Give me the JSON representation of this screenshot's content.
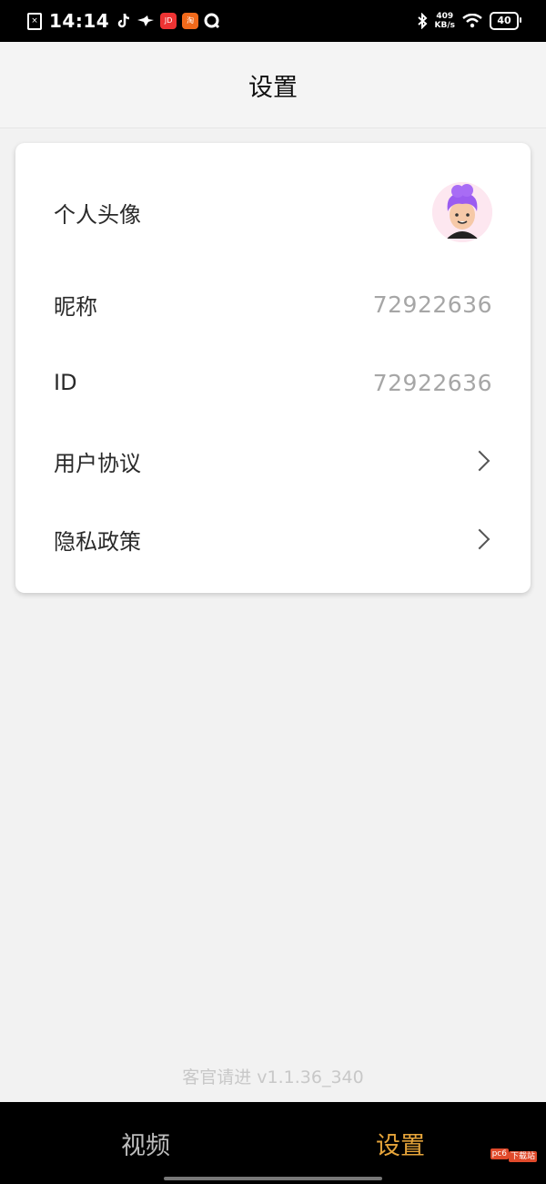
{
  "status_bar": {
    "time": "14:14",
    "net_speed_value": "409",
    "net_speed_unit": "KB/s",
    "battery": "40"
  },
  "header": {
    "title": "设置"
  },
  "settings": {
    "avatar_label": "个人头像",
    "nickname_label": "昵称",
    "nickname_value": "72922636",
    "id_label": "ID",
    "id_value": "72922636",
    "user_agreement_label": "用户协议",
    "privacy_policy_label": "隐私政策"
  },
  "footer": {
    "version": "客官请进 v1.1.36_340"
  },
  "bottom_nav": {
    "items": [
      {
        "label": "视频",
        "active": false
      },
      {
        "label": "设置",
        "active": true
      }
    ]
  },
  "watermark": {
    "main": "pc6",
    "tag": "下载站"
  },
  "colors": {
    "accent": "#e6a43a",
    "inactive": "#bdbdbd"
  }
}
